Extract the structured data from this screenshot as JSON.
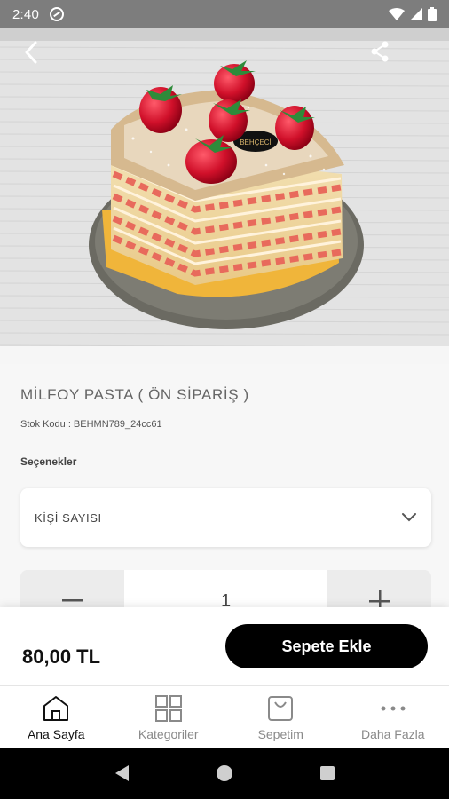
{
  "status_bar": {
    "time": "2:40"
  },
  "product": {
    "title": "MİLFOY PASTA ( ÖN SİPARİŞ )",
    "sku": "Stok Kodu : BEHMN789_24cc61",
    "options_label": "Seçenekler",
    "select_placeholder": "KİŞİ SAYISI",
    "quantity": "1",
    "price": "80,00 TL",
    "add_to_cart_label": "Sepete Ekle",
    "cake_brand": "BEHÇECİ"
  },
  "bottom_nav": {
    "items": [
      {
        "label": "Ana Sayfa",
        "icon": "home-icon"
      },
      {
        "label": "Kategoriler",
        "icon": "grid-icon"
      },
      {
        "label": "Sepetim",
        "icon": "bag-icon"
      },
      {
        "label": "Daha Fazla",
        "icon": "more-icon"
      }
    ]
  },
  "colors": {
    "accent": "#000000",
    "status_bar": "#7d7d7d",
    "strawberry": "#c8102e"
  }
}
